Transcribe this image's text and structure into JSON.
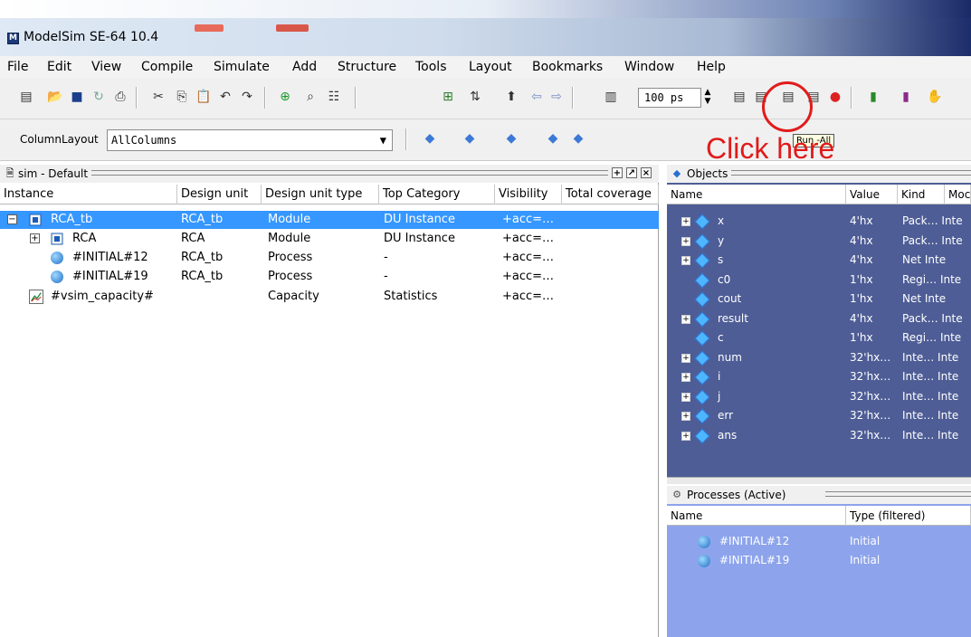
{
  "window": {
    "title": "ModelSim SE-64 10.4"
  },
  "menu": [
    "File",
    "Edit",
    "View",
    "Compile",
    "Simulate",
    "Add",
    "Structure",
    "Tools",
    "Layout",
    "Bookmarks",
    "Window",
    "Help"
  ],
  "toolbar": {
    "run_length": "100 ps",
    "tooltip": "Run -All",
    "column_layout_label": "ColumnLayout",
    "column_layout_value": "AllColumns"
  },
  "annotation": {
    "text": "Click here",
    "color": "#e01a1a"
  },
  "sim_panel": {
    "title": "sim - Default",
    "columns": [
      "Instance",
      "Design unit",
      "Design unit type",
      "Top Category",
      "Visibility",
      "Total coverage"
    ],
    "rows": [
      {
        "instance": "RCA_tb",
        "design_unit": "RCA_tb",
        "type": "Module",
        "category": "DU Instance",
        "visibility": "+acc=…"
      },
      {
        "instance": "RCA",
        "design_unit": "RCA",
        "type": "Module",
        "category": "DU Instance",
        "visibility": "+acc=…"
      },
      {
        "instance": "#INITIAL#12",
        "design_unit": "RCA_tb",
        "type": "Process",
        "category": "-",
        "visibility": "+acc=…"
      },
      {
        "instance": "#INITIAL#19",
        "design_unit": "RCA_tb",
        "type": "Process",
        "category": "-",
        "visibility": "+acc=…"
      },
      {
        "instance": "#vsim_capacity#",
        "design_unit": "",
        "type": "Capacity",
        "category": "Statistics",
        "visibility": "+acc=…"
      }
    ]
  },
  "objects_panel": {
    "title": "Objects",
    "columns": [
      "Name",
      "Value",
      "Kind",
      "Moc"
    ],
    "rows": [
      {
        "name": "x",
        "value": "4'hx",
        "kind": "Pack… Inte",
        "expandable": true
      },
      {
        "name": "y",
        "value": "4'hx",
        "kind": "Pack… Inte",
        "expandable": true
      },
      {
        "name": "s",
        "value": "4'hx",
        "kind": "Net   Inte",
        "expandable": true
      },
      {
        "name": "c0",
        "value": "1'hx",
        "kind": "Regi… Inte",
        "expandable": false
      },
      {
        "name": "cout",
        "value": "1'hx",
        "kind": "Net   Inte",
        "expandable": false
      },
      {
        "name": "result",
        "value": "4'hx",
        "kind": "Pack… Inte",
        "expandable": true
      },
      {
        "name": "c",
        "value": "1'hx",
        "kind": "Regi… Inte",
        "expandable": false
      },
      {
        "name": "num",
        "value": "32'hx…",
        "kind": "Inte… Inte",
        "expandable": true
      },
      {
        "name": "i",
        "value": "32'hx…",
        "kind": "Inte… Inte",
        "expandable": true
      },
      {
        "name": "j",
        "value": "32'hx…",
        "kind": "Inte… Inte",
        "expandable": true
      },
      {
        "name": "err",
        "value": "32'hx…",
        "kind": "Inte… Inte",
        "expandable": true
      },
      {
        "name": "ans",
        "value": "32'hx…",
        "kind": "Inte… Inte",
        "expandable": true
      }
    ]
  },
  "processes_panel": {
    "title": "Processes (Active)",
    "columns": [
      "Name",
      "Type (filtered)"
    ],
    "rows": [
      {
        "name": "#INITIAL#12",
        "type": "Initial"
      },
      {
        "name": "#INITIAL#19",
        "type": "Initial"
      }
    ]
  }
}
